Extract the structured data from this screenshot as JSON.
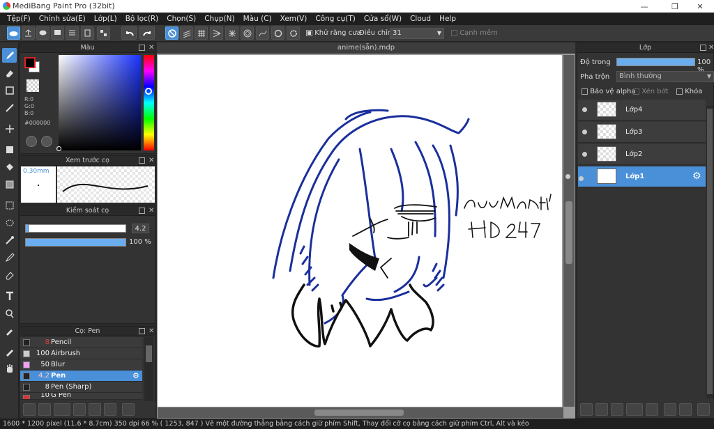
{
  "app": {
    "title": "MediBang Paint Pro (32bit)"
  },
  "menu": [
    "Tệp(F)",
    "Chỉnh sửa(E)",
    "Lớp(L)",
    "Bộ lọc(R)",
    "Chọn(S)",
    "Chụp(N)",
    "Màu (C)",
    "Xem(V)",
    "Công cụ(T)",
    "Cửa sổ(W)",
    "Cloud",
    "Help"
  ],
  "toolbar": {
    "antialias_label": "Khử răng cưa",
    "adjust_label": "Điều chỉnh",
    "adjust_value": "31",
    "soft_edge_label": "Cạnh mềm"
  },
  "color_panel": {
    "title": "Màu",
    "r": "R:0",
    "g": "G:0",
    "b": "B:0",
    "hex": "#000000",
    "fg_color": "#000000",
    "bg_color": "#ffffff"
  },
  "brush_preview": {
    "title": "Xem trước cọ",
    "size": "0.30mm"
  },
  "brush_control": {
    "title": "Kiểm soát cọ",
    "size_value": "4.2",
    "opacity_value": "100 %",
    "size_fraction": 0.03,
    "opacity_fraction": 1.0
  },
  "brush_list": {
    "title": "Cọ: Pen",
    "items": [
      {
        "size": "8",
        "name": "Pencil",
        "swatch": "#222222"
      },
      {
        "size": "100",
        "name": "Airbrush",
        "swatch": "#cccccc"
      },
      {
        "size": "50",
        "name": "Blur",
        "swatch": "#f2a0f2"
      },
      {
        "size": "4.2",
        "name": "Pen",
        "swatch": "#222222"
      },
      {
        "size": "8",
        "name": "Pen (Sharp)",
        "swatch": "#222222"
      },
      {
        "size": "10",
        "name": "G Pen",
        "swatch": "#e03030"
      }
    ]
  },
  "document": {
    "tab": "anime(sẵn).mdp"
  },
  "layers_panel": {
    "title": "Lớp",
    "opacity_label": "Độ trong",
    "opacity_value": "100 %",
    "blend_label": "Pha trộn",
    "blend_value": "Bình thường",
    "protect_alpha": "Bảo vệ alpha",
    "clipping": "Xén bớt",
    "lock": "Khóa",
    "layers": [
      "Lớp4",
      "Lớp3",
      "Lớp2",
      "Lớp1"
    ]
  },
  "artwork": {
    "signature_line1": "DuyManh14",
    "signature_line2": "HD247",
    "ink_color": "#1a2f9c"
  },
  "status": {
    "text": "1600 * 1200 pixel   (11.6 * 8.7cm)   350 dpi   66 %   ( 1253, 847 )   Vẽ một đường thẳng bằng cách giữ phím Shift, Thay đổi cỡ cọ bằng cách giữ phím Ctrl, Alt và kéo"
  }
}
